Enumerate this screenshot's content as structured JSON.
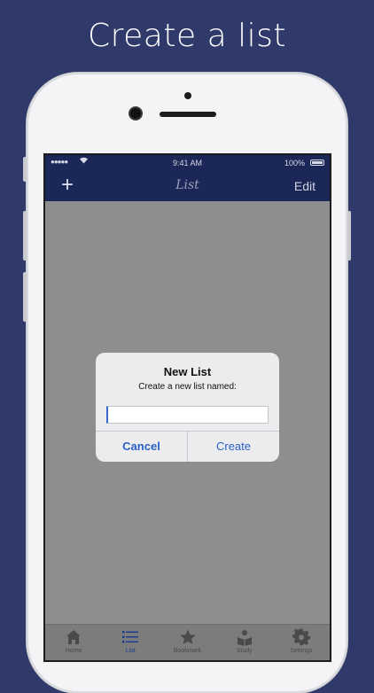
{
  "headline": "Create a list",
  "status_bar": {
    "signal": "●●●●●",
    "time": "9:41 AM",
    "battery_pct": "100%"
  },
  "nav": {
    "add_label": "+",
    "title": "List",
    "edit_label": "Edit"
  },
  "dialog": {
    "title": "New List",
    "message": "Create a new list named:",
    "input_value": "",
    "cancel_label": "Cancel",
    "create_label": "Create"
  },
  "tabs": [
    {
      "label": "Home",
      "icon": "home-icon"
    },
    {
      "label": "List",
      "icon": "list-icon",
      "active": true
    },
    {
      "label": "Bookmark",
      "icon": "star-icon"
    },
    {
      "label": "Study",
      "icon": "study-icon"
    },
    {
      "label": "Settings",
      "icon": "gear-icon"
    }
  ],
  "colors": {
    "background": "#2f3a6b",
    "navbar": "#1a2757",
    "accent": "#2a62c9",
    "active_tab": "#1c3d8f"
  }
}
